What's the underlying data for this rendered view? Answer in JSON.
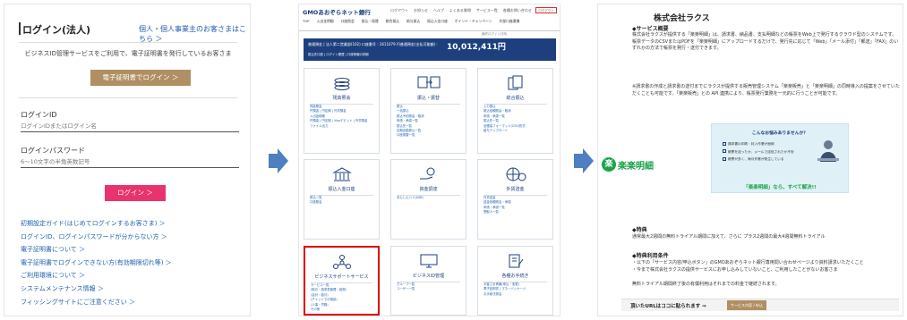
{
  "login": {
    "title": "ログイン(法人)",
    "top_link": "個人・個人事業主のお客さまはこちら ＞",
    "description": "ビジネスID管理サービスをご利用で、電子証明書を発行しているお客さま",
    "cert_button": "電子証明書でログイン ＞",
    "id_label": "ログインID",
    "id_placeholder": "ログインIDまたはログイン名",
    "pw_label": "ログインパスワード",
    "pw_placeholder": "6～10文字の半角英数記号",
    "login_button": "ログイン ＞",
    "links": [
      "初期設定ガイド(はじめてログインするお客さま) ＞",
      "ログインID、ログインパスワードが分からない方 ＞",
      "電子証明書について ＞",
      "電子証明書でログインできない方(有効期限切れ等) ＞",
      "ご利用環境について ＞",
      "システムメンテナンス情報 ＞",
      "フィッシングサイトにご注意ください ＞"
    ]
  },
  "bank": {
    "logo": "GMOあおぞらネット銀行",
    "top_icons": [
      "ログアウト",
      "お知らせ",
      "ヘルプ",
      "よくある質問",
      "サービス一覧",
      "各種お問い合わせ",
      "お客さま番号"
    ],
    "top_button": "ログアウト",
    "menu": [
      "TOP",
      "入出金明細",
      "口座照会",
      "振込・振替",
      "総合振込",
      "給与振込",
      "振込入金口座",
      "ポイント・キャンペーン",
      "外部口座連携"
    ],
    "crumb": "最終ログイン日時",
    "account_line": "普通預金 | 法人第二営業部(102) 口座番号 : 1611079 円普通預金(支払可能額) :",
    "amount": "10,012,411円",
    "account_line2": "振込先口座 | ログイン履歴 | 口座情報の詳細",
    "tiles": [
      {
        "title": "残高照会",
        "items": [
          "残高照会",
          "円預金 | 円定期 | 外貨預金",
          "入出金明細",
          "円預金 | 円定期 | Visaデビット | 外貨預金",
          "ファイル出力"
        ]
      },
      {
        "title": "振込・振替",
        "items": [
          "振込",
          "一括振込",
          "振込予約照会・取消",
          "申請・承認一覧",
          "振込先一覧",
          "定期自動振込一覧",
          "口座振替一覧"
        ]
      },
      {
        "title": "総合振込",
        "items": [
          "入力振込",
          "振込依頼照会・取消",
          "申請・承認一覧",
          "振込先一覧",
          "全銀協フォーマット(CSV)形式",
          "給与アップロード"
        ]
      },
      {
        "title": "振込入金口座",
        "items": [
          "振込一覧",
          "口座照会"
        ]
      },
      {
        "title": "資金調達",
        "items": [
          "あんしんバイ(ASB)"
        ]
      },
      {
        "title": "外貨送金",
        "items": [
          "外貨送金",
          "送金依頼照会・承認",
          "申請・承認一覧",
          "受取人一覧"
        ]
      },
      {
        "title": "ビジネスサポートサービス",
        "items": [
          "サービス一覧",
          "(取引・請求書管理・経費)",
          "(会計・給与)",
          "(チャットでの相談)",
          "(人事・労務)",
          "その他"
        ]
      },
      {
        "title": "ビジネスID管理",
        "items": [
          "グループ一覧",
          "ユーザー一覧"
        ]
      },
      {
        "title": "各種お手続き",
        "items": [
          "お客さま情報(申込・変更)",
          "電子証明書 | マネーパッケージ",
          "お手続き照会"
        ]
      }
    ]
  },
  "raksul": {
    "company": "株式会社ラクス",
    "section1": "◆サービス概要",
    "para1": "株式会社ラクスが提供する「楽楽明細」は、請求書、納品書、支払明細などの帳票をWeb上で発行するクラウド型のシステムです。帳票データのCSVまたはPDFを「楽楽明細」にアップロードするだけで、発行先に応じて「Web」「メール添付」「郵送」「FAX」のいずれかの方法で帳票を発行・送付できます。",
    "para2": "※請求書の作成と請求書の送付までにラクスが提供する販売管理システム「楽楽販売」と「楽楽明細」の同時導入の提案をさせていただくことも可能です。「楽楽販売」との API 連携により、帳票発行業務を一元的に行うことが可能です。",
    "logo_mark": "楽",
    "logo_name": "楽楽明細",
    "banner_question": "こんなお悩みありませんか？",
    "banner_checks": [
      "請求書の印刷・封入作業が面倒",
      "帳票を送ったか、メールで送信されたか不安",
      "帳票が多く、毎月作業が発生している"
    ],
    "banner_footer": "「楽楽明細」なら、すべて解決!!",
    "section2": "◆特典",
    "para3": "通常最大2週間の無料トライアル期間に加えて、さらに プラス2週間の最大4週間無料トライアル",
    "section3": "◆特典利用条件",
    "para4": "・以下の「サービス内容/申込ボタン」のGMOあおぞらネット銀行専用問い合わせページより資料請求いただくこと\n・今まで株式会社ラクスの提供サービスにお申し込みしていないこと、ご利用したことがないお客さま",
    "para5": "無料トライアル期間終了後の有償利用はそれまでの料金で継続されます。",
    "bottom_label": "頂いたURLはココに貼られます ⇒",
    "bottom_button": "サービス内容 / 申込"
  }
}
